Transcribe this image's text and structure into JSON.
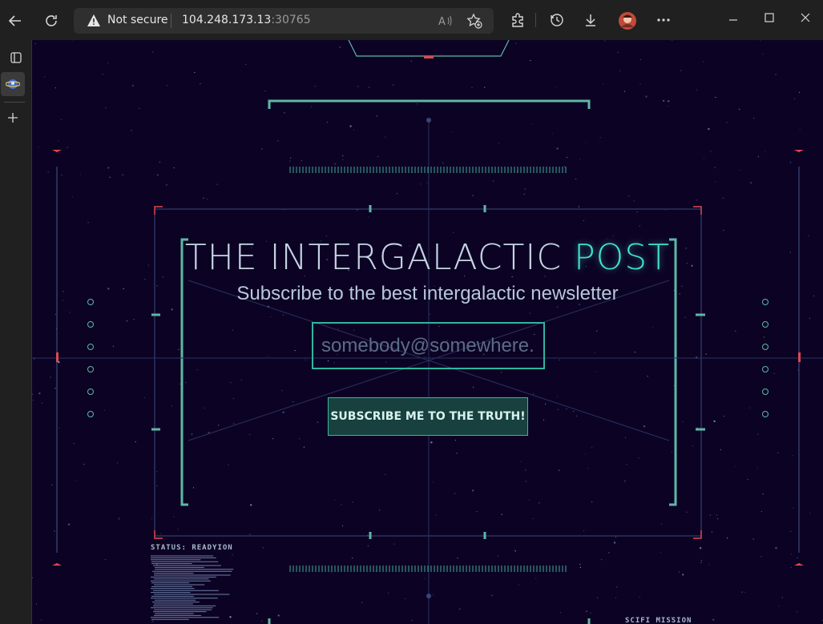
{
  "browser": {
    "security_label": "Not secure",
    "url_host": "104.248.173.13",
    "url_port": ":30765"
  },
  "page": {
    "title_main": "THE INTERGALACTIC ",
    "title_accent": "POST",
    "subtitle": "Subscribe to the best intergalactic newsletter",
    "email_placeholder": "somebody@somewhere.com",
    "subscribe_label": "SUBSCRIBE ME TO THE TRUTH!",
    "status_label": "STATUS: READYION",
    "mission_label": "SCIFI MISSION"
  },
  "colors": {
    "background": "#0c0324",
    "accent": "#43e0c8",
    "hud_line": "#5fb7a6",
    "hud_red": "#e0484f"
  }
}
